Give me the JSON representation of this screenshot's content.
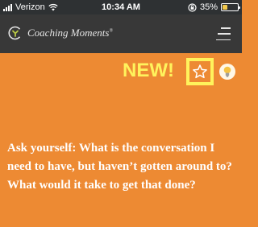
{
  "status_bar": {
    "carrier": "Verizon",
    "time": "10:34 AM",
    "battery_percent": "35%",
    "battery_level": 0.35,
    "icons": [
      "signal-icon",
      "wifi-icon",
      "rotation-lock-icon",
      "battery-icon"
    ]
  },
  "nav": {
    "brand": "Coaching Moments",
    "brand_mark": "®",
    "icons": [
      "logo-icon",
      "menu-icon"
    ]
  },
  "content": {
    "new_label": "NEW!",
    "prompt": "Ask yourself:  What is the conversation I need to have, but haven’t gotten around to?  What would it take to get that done?",
    "icons": [
      "star-icon",
      "lightbulb-icon"
    ]
  },
  "colors": {
    "background": "#ED8A33",
    "nav": "#383838",
    "status_bar": "#2E3133",
    "highlight": "#FFF35C",
    "logo_green": "#B9C945"
  }
}
